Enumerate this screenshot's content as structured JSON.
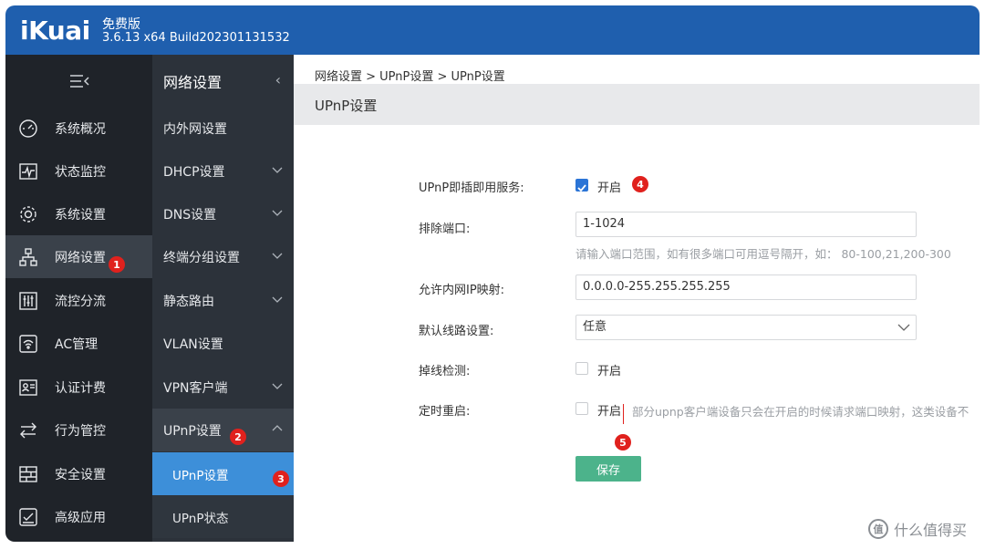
{
  "header": {
    "logo": "iKuai",
    "edition": "免费版",
    "version": "3.6.13 x64 Build202301131532"
  },
  "sidebar": {
    "toggle_icon": "menu-collapse-icon",
    "items": [
      {
        "label": "系统概况",
        "icon": "gauge-icon"
      },
      {
        "label": "状态监控",
        "icon": "pulse-icon"
      },
      {
        "label": "系统设置",
        "icon": "gear-icon"
      },
      {
        "label": "网络设置",
        "icon": "network-icon"
      },
      {
        "label": "流控分流",
        "icon": "sliders-icon"
      },
      {
        "label": "AC管理",
        "icon": "wifi-icon"
      },
      {
        "label": "认证计费",
        "icon": "id-card-icon"
      },
      {
        "label": "行为管控",
        "icon": "arrows-icon"
      },
      {
        "label": "安全设置",
        "icon": "firewall-icon"
      },
      {
        "label": "高级应用",
        "icon": "checklist-icon"
      }
    ]
  },
  "subnav": {
    "title": "网络设置",
    "items": [
      {
        "label": "内外网设置"
      },
      {
        "label": "DHCP设置"
      },
      {
        "label": "DNS设置"
      },
      {
        "label": "终端分组设置"
      },
      {
        "label": "静态路由"
      },
      {
        "label": "VLAN设置"
      },
      {
        "label": "VPN客户端"
      },
      {
        "label": "UPnP设置"
      }
    ],
    "subitems": [
      {
        "label": "UPnP设置"
      },
      {
        "label": "UPnP状态"
      }
    ]
  },
  "badges": [
    "1",
    "2",
    "3",
    "4",
    "5"
  ],
  "main": {
    "breadcrumb": "网络设置 > UPnP设置 > UPnP设置",
    "section_title": "UPnP设置",
    "form": {
      "upnp_service_label": "UPnP即插即用服务:",
      "upnp_service_option": "开启",
      "upnp_service_checked": true,
      "exclude_ports_label": "排除端口:",
      "exclude_ports_value": "1-1024",
      "exclude_ports_hint": "请输入端口范围，如有很多端口可用逗号隔开，如：  80-100,21,200-300",
      "allow_ip_label": "允许内网IP映射:",
      "allow_ip_value": "0.0.0.0-255.255.255.255",
      "default_line_label": "默认线路设置:",
      "default_line_value": "任意",
      "drop_detect_label": "掉线检测:",
      "drop_detect_option": "开启",
      "drop_detect_checked": false,
      "timed_reboot_label": "定时重启:",
      "timed_reboot_option": "开启",
      "timed_reboot_checked": false,
      "timed_reboot_note": "部分upnp客户端设备只会在开启的时候请求端口映射，这类设备不",
      "save_label": "保存"
    }
  },
  "watermark": {
    "text": "什么值得买",
    "glyph": "值"
  },
  "colors": {
    "topbar": "#1f5fae",
    "sidebar": "#1f2329",
    "subnav": "#2c323a",
    "selected": "#3d8fd9",
    "save": "#4cb38b",
    "badge": "#e0211d",
    "checkbox_on": "#2b74d6"
  }
}
